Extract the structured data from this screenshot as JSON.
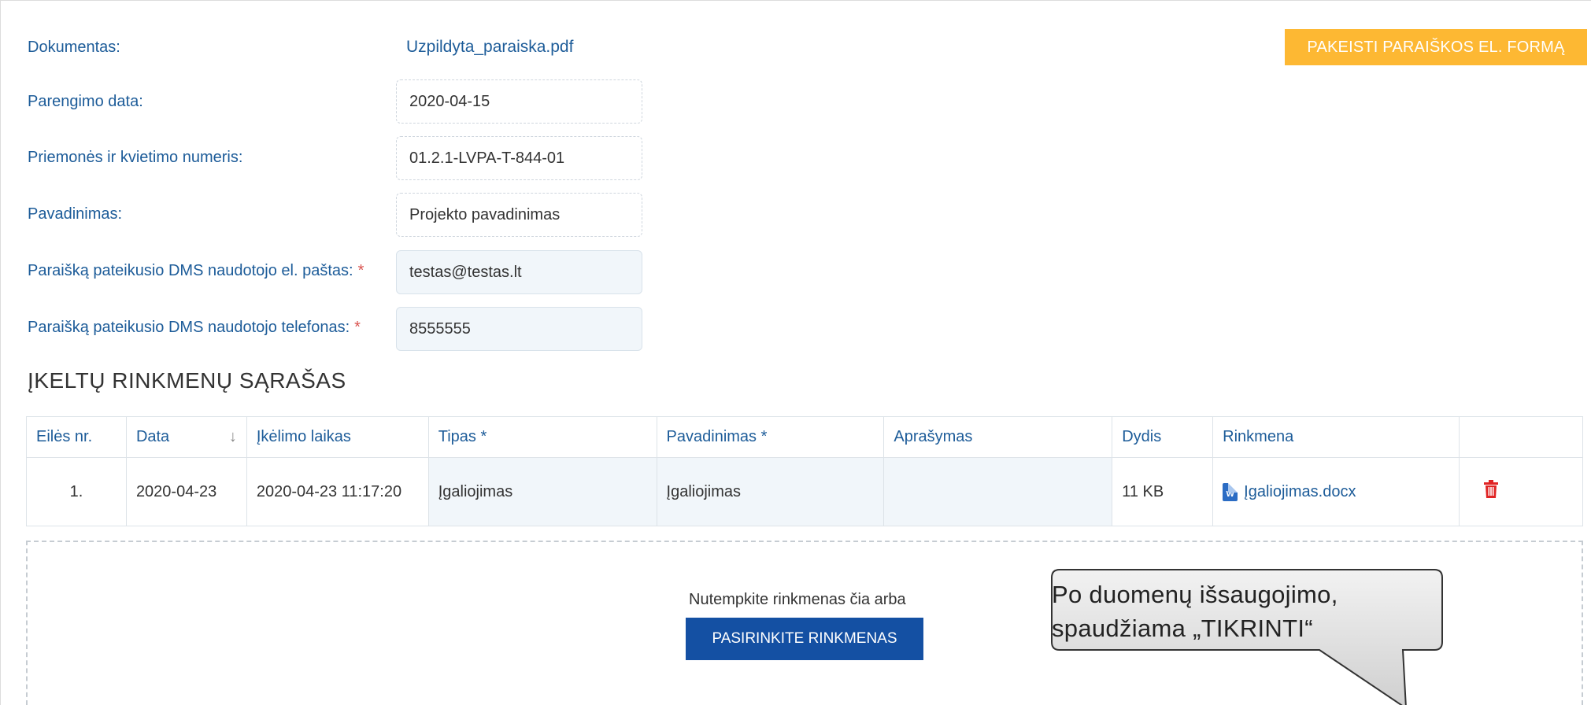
{
  "form": {
    "document_label": "Dokumentas:",
    "document_value": "Uzpildyta_paraiska.pdf",
    "prep_date_label": "Parengimo data:",
    "prep_date_value": "2020-04-15",
    "measure_label": "Priemonės ir kvietimo numeris:",
    "measure_value": "01.2.1-LVPA-T-844-01",
    "name_label": "Pavadinimas:",
    "name_value": "Projekto pavadinimas",
    "email_label": "Paraišką pateikusio DMS naudotojo el. paštas:",
    "email_value": "testas@testas.lt",
    "phone_label": "Paraišką pateikusio DMS naudotojo telefonas:",
    "phone_value": "8555555",
    "required_mark": "*"
  },
  "actions": {
    "change_form_label": "PAKEISTI PARAIŠKOS EL. FORMĄ"
  },
  "files_section": {
    "title": "ĮKELTŲ RINKMENŲ SĄRAŠAS",
    "columns": [
      "Eilės nr.",
      "Data",
      "Įkėlimo laikas",
      "Tipas *",
      "Pavadinimas *",
      "Aprašymas",
      "Dydis",
      "Rinkmena",
      ""
    ],
    "sort_arrow": "↓",
    "rows": [
      {
        "nr": "1.",
        "date": "2020-04-23",
        "upload_time": "2020-04-23 11:17:20",
        "type": "Įgaliojimas",
        "name": "Įgaliojimas",
        "description": "",
        "size": "11 KB",
        "file": "Įgaliojimas.docx",
        "file_icon": "w"
      }
    ]
  },
  "dropzone": {
    "text": "Nutempkite rinkmenas čia arba",
    "button_label": "PASIRINKITE RINKMENAS"
  },
  "callout": {
    "line1": "Po duomenų išsaugojimo,",
    "line2": "spaudžiama „TIKRINTI“"
  }
}
